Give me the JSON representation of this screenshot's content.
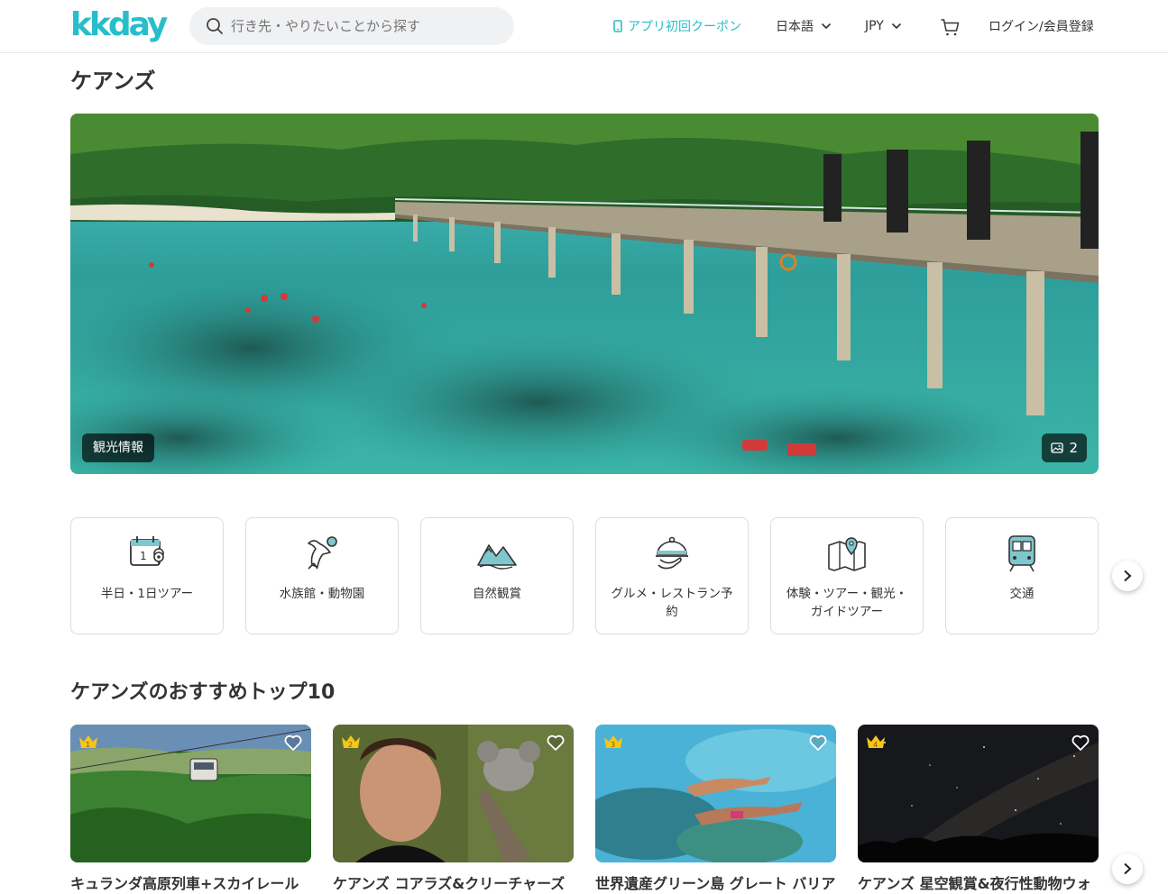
{
  "header": {
    "logo": "kkday",
    "search_placeholder": "行き先・やりたいことから探す",
    "coupon_label": "アプリ初回クーポン",
    "language": "日本語",
    "currency": "JPY",
    "login_label": "ログイン/会員登録"
  },
  "city": {
    "title": "ケアンズ"
  },
  "hero": {
    "badge": "観光情報",
    "image_count": "2"
  },
  "categories": [
    {
      "label": "半日・1日ツアー",
      "icon": "calendar-pin-icon"
    },
    {
      "label": "水族館・動物園",
      "icon": "seal-ball-icon"
    },
    {
      "label": "自然観賞",
      "icon": "mountain-icon"
    },
    {
      "label": "グルメ・レストラン予約",
      "icon": "food-cloche-icon"
    },
    {
      "label": "体験・ツアー・観光・ガイドツアー",
      "icon": "map-pin-icon"
    },
    {
      "label": "交通",
      "icon": "train-icon"
    }
  ],
  "top10": {
    "title": "ケアンズのおすすめトップ10",
    "items": [
      {
        "rank": "1",
        "title": "キュランダ高原列車+スカイレール"
      },
      {
        "rank": "2",
        "title": "ケアンズ コアラズ&クリーチャーズ"
      },
      {
        "rank": "3",
        "title": "世界遺産グリーン島 グレート バリア"
      },
      {
        "rank": "4",
        "title": "ケアンズ 星空観賞&夜行性動物ウォ"
      }
    ]
  },
  "colors": {
    "accent": "#26bec9",
    "crown": "#f5c518",
    "icon_teal": "#3e8f9c"
  }
}
